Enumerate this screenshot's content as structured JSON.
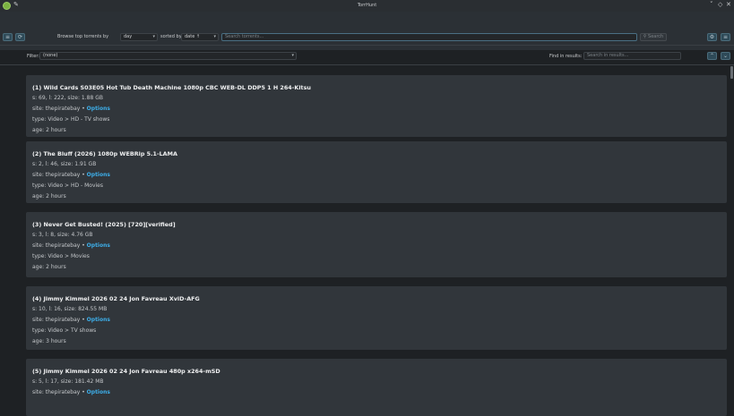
{
  "window": {
    "title": "TorrHunt",
    "minimize_glyph": "˅",
    "maximize_glyph": "◇",
    "close_glyph": "✕",
    "pin_glyph": "✎"
  },
  "toolbar": {
    "browse_label": "Browse top torrents by",
    "period_value": "day",
    "sorted_by_label": "sorted by",
    "sort_value": "date ↑",
    "search_placeholder": "Search torrents...",
    "search_button_label": "Search",
    "search_icon": "⚲",
    "menu_icon": "≡",
    "refresh_icon": "⟳",
    "settings_icon": "⚙",
    "hamburger_icon": "≡"
  },
  "filter": {
    "label": "Filter:",
    "value": "(none)",
    "find_label": "Find in results:",
    "find_placeholder": "Search in results...",
    "up_icon": "⌃",
    "down_icon": "⌄"
  },
  "results": [
    {
      "title": "(1) Wild Cards S03E05 Hot Tub Death Machine 1080p CBC WEB-DL DDP5 1 H 264-Kitsu",
      "stats": "s: 69, l: 222, size: 1.88 GB",
      "site_prefix": "site: thepiratebay • ",
      "options": "Options",
      "type": "type: Video > HD - TV shows",
      "age": "age: 2 hours"
    },
    {
      "title": "(2) The Bluff (2026) 1080p WEBRip 5.1-LAMA",
      "stats": "s: 2, l: 46, size: 1.91 GB",
      "site_prefix": "site: thepiratebay • ",
      "options": "Options",
      "type": "type: Video > HD - Movies",
      "age": "age: 2 hours"
    },
    {
      "title": "(3) Never Get Busted! (2025) [720][verified]",
      "stats": "s: 3, l: 8, size: 4.76 GB",
      "site_prefix": "site: thepiratebay • ",
      "options": "Options",
      "type": "type: Video > Movies",
      "age": "age: 2 hours"
    },
    {
      "title": "(4) Jimmy Kimmel 2026 02 24 Jon Favreau XviD-AFG",
      "stats": "s: 10, l: 16, size: 824.55 MB",
      "site_prefix": "site: thepiratebay • ",
      "options": "Options",
      "type": "type: Video > TV shows",
      "age": "age: 3 hours"
    },
    {
      "title": "(5) Jimmy Kimmel 2026 02 24 Jon Favreau 480p x264-mSD",
      "stats": "s: 5, l: 17, size: 181.42 MB",
      "site_prefix": "site: thepiratebay • ",
      "options": "Options"
    }
  ],
  "colors": {
    "accent": "#3daee9",
    "background": "#1e2124",
    "card": "#31363b",
    "app_icon": "#7cb342"
  }
}
